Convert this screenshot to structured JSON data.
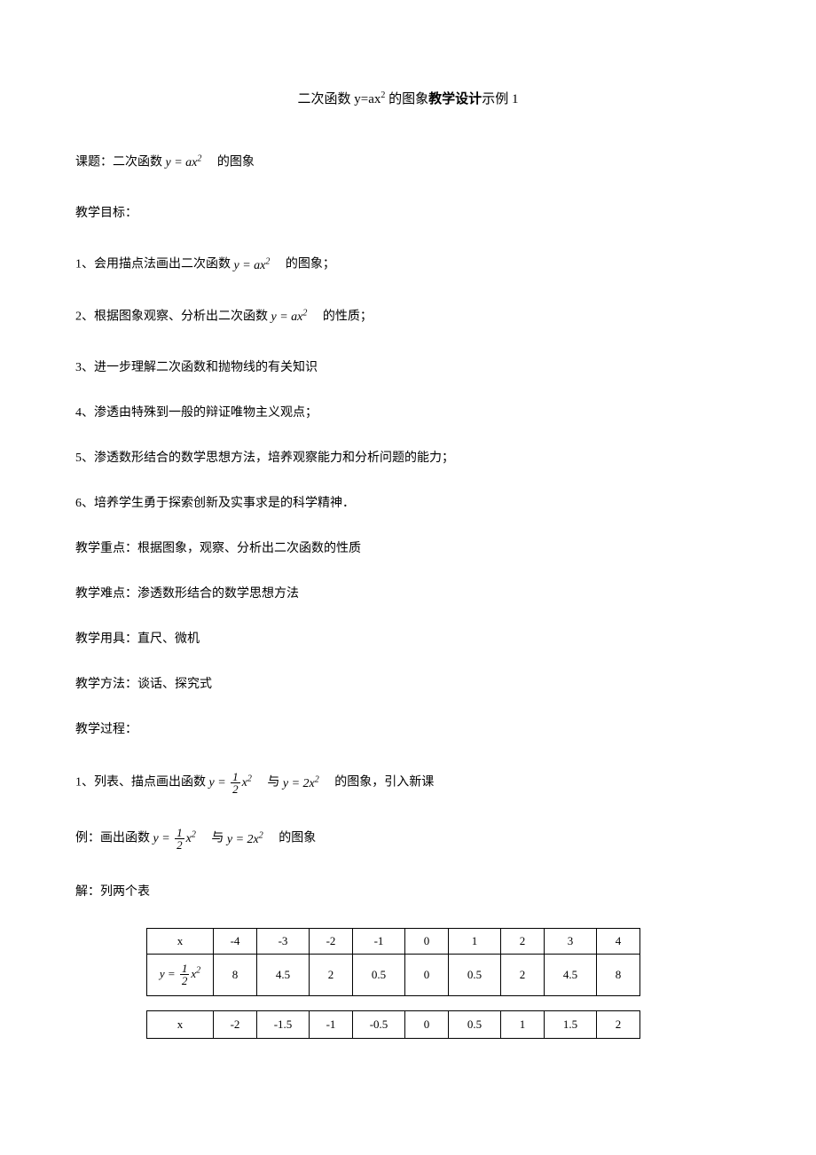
{
  "title": {
    "prefix": "二次函数 y=ax",
    "sup": "2",
    "mid": " 的图象",
    "bold": "教学设计",
    "suffix": "示例 1"
  },
  "lines": {
    "topic_prefix": "课题：二次函数",
    "topic_formula_y": "y = ax",
    "topic_formula_sup": "2",
    "topic_suffix": "　的图象",
    "goal_heading": "教学目标：",
    "g1_prefix": "1、会用描点法画出二次函数",
    "g1_suffix": "　的图象；",
    "g2_prefix": "2、根据图象观察、分析出二次函数",
    "g2_suffix": "　的性质；",
    "g3": "3、进一步理解二次函数和抛物线的有关知识",
    "g4": "4、渗透由特殊到一般的辩证唯物主义观点；",
    "g5": "5、渗透数形结合的数学思想方法，培养观察能力和分析问题的能力；",
    "g6": "6、培养学生勇于探索创新及实事求是的科学精神．",
    "key_point": "教学重点：根据图象，观察、分析出二次函数的性质",
    "difficulty": "教学难点：渗透数形结合的数学思想方法",
    "tools": "教学用具：直尺、微机",
    "method": "教学方法：谈话、探究式",
    "process": "教学过程：",
    "proc1_prefix": "1、列表、描点画出函数",
    "proc1_mid": "　与",
    "proc1_suffix": "　的图象，引入新课",
    "ex_prefix": "例：画出函数",
    "ex_mid": "　与",
    "ex_suffix": "　的图象",
    "solution": "解：列两个表",
    "y_eq": "y = ",
    "y_half_frac_num": "1",
    "y_half_frac_den": "2",
    "x2": "x",
    "x2_sup": "2",
    "y_2x2": "y = 2x",
    "x_label": "x"
  },
  "table1": {
    "row1": [
      "x",
      "-4",
      "-3",
      "-2",
      "-1",
      "0",
      "1",
      "2",
      "3",
      "4"
    ],
    "row2_label_prefix": "y = ",
    "row2_frac_num": "1",
    "row2_frac_den": "2",
    "row2_label_suffix_x": "x",
    "row2_label_suffix_sup": "2",
    "row2": [
      "8",
      "4.5",
      "2",
      "0.5",
      "0",
      "0.5",
      "2",
      "4.5",
      "8"
    ]
  },
  "table2": {
    "row1": [
      "x",
      "-2",
      "-1.5",
      "-1",
      "-0.5",
      "0",
      "0.5",
      "1",
      "1.5",
      "2"
    ]
  }
}
